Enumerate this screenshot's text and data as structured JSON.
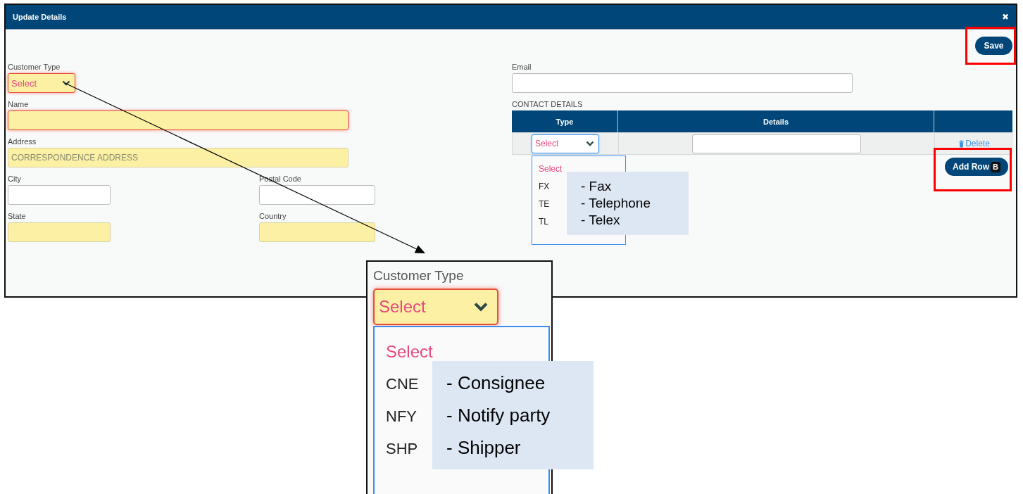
{
  "window": {
    "title": "Update Details",
    "close": "✖"
  },
  "save_button": {
    "label": "Save",
    "highlighted": true
  },
  "field_rows": [
    [
      {
        "kind": "select",
        "label": "Customer Type",
        "value": "Select",
        "required": true,
        "error": true
      }
    ],
    [
      {
        "kind": "text",
        "label": "Name",
        "required": true,
        "error": true
      }
    ],
    [
      {
        "kind": "text",
        "label": "Address",
        "placeholder": "CORRESPONDENCE ADDRESS",
        "required": true,
        "error": false
      }
    ],
    [
      {
        "kind": "text",
        "label": "City",
        "required": false,
        "error": false
      },
      {
        "kind": "text",
        "label": "Postal Code",
        "required": false,
        "error": false
      }
    ],
    [
      {
        "kind": "text",
        "label": "State",
        "required": true,
        "error": false
      },
      {
        "kind": "text",
        "label": "Country",
        "required": true,
        "error": false
      }
    ]
  ],
  "email": {
    "label": "Email"
  },
  "contact_details": {
    "title": "CONTACT DETAILS",
    "columns": [
      "Type",
      "Details"
    ],
    "rows": [
      {
        "type": {
          "value": "Select",
          "focused": true,
          "menu": {
            "placeholder_option": "Select",
            "options": [
              "FX",
              "TE",
              "TL"
            ],
            "notes": [
              "- Fax",
              "- Telephone",
              "- Telex"
            ]
          }
        },
        "delete": "Delete"
      }
    ],
    "add_row": {
      "label": "Add Row",
      "shortcut": "B",
      "highlighted": true
    }
  },
  "zoom_inset": {
    "label": "Customer Type",
    "value": "Select",
    "error": true,
    "placeholder_option": "Select",
    "options": [
      "CNE",
      "NFY",
      "SHP"
    ],
    "notes": [
      "- Consignee",
      "- Notify party",
      "- Shipper"
    ]
  }
}
